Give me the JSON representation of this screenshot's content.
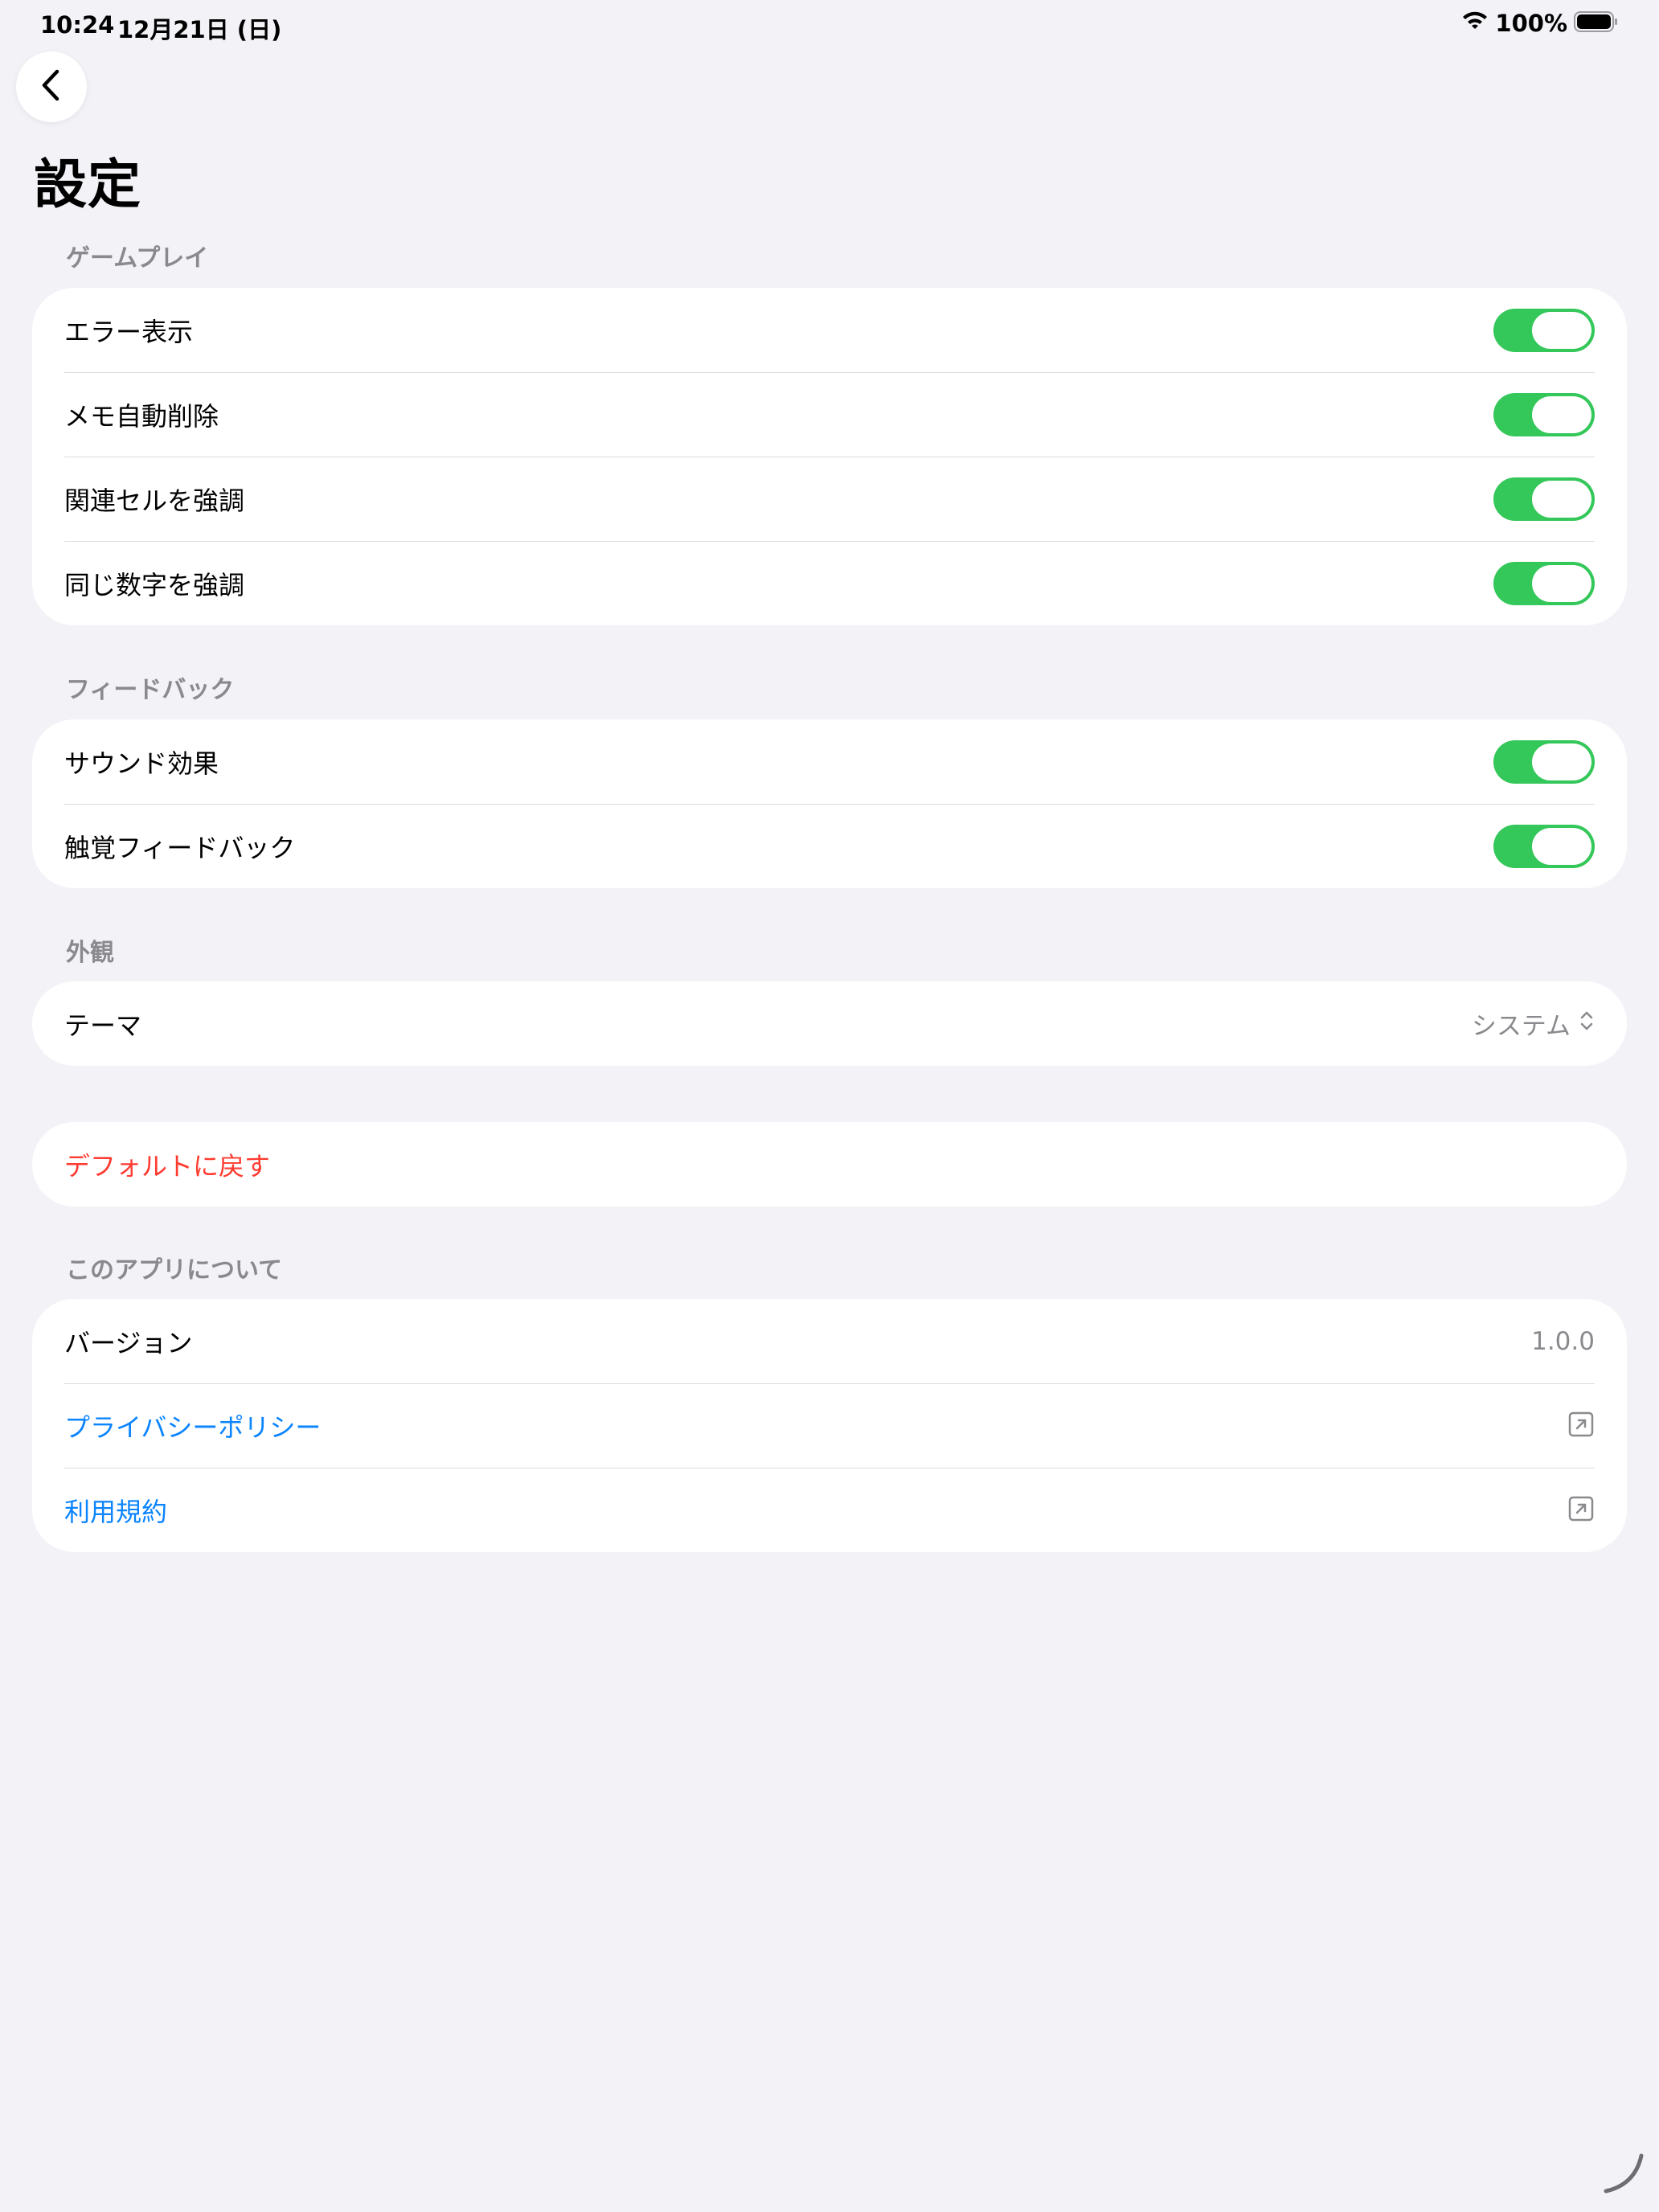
{
  "status_bar": {
    "time": "10:24",
    "date": "12月21日 (日)",
    "battery": "100%"
  },
  "title": "設定",
  "sections": {
    "gameplay": {
      "header": "ゲームプレイ",
      "items": [
        {
          "label": "エラー表示",
          "on": true
        },
        {
          "label": "メモ自動削除",
          "on": true
        },
        {
          "label": "関連セルを強調",
          "on": true
        },
        {
          "label": "同じ数字を強調",
          "on": true
        }
      ]
    },
    "feedback": {
      "header": "フィードバック",
      "items": [
        {
          "label": "サウンド効果",
          "on": true
        },
        {
          "label": "触覚フィードバック",
          "on": true
        }
      ]
    },
    "appearance": {
      "header": "外観",
      "theme_label": "テーマ",
      "theme_value": "システム"
    },
    "reset": {
      "label": "デフォルトに戻す"
    },
    "about": {
      "header": "このアプリについて",
      "version_label": "バージョン",
      "version_value": "1.0.0",
      "privacy_label": "プライバシーポリシー",
      "terms_label": "利用規約"
    }
  },
  "colors": {
    "toggle_on": "#34c759",
    "link": "#0a84ff",
    "destructive": "#ff3b30",
    "background": "#f2f2f7"
  }
}
